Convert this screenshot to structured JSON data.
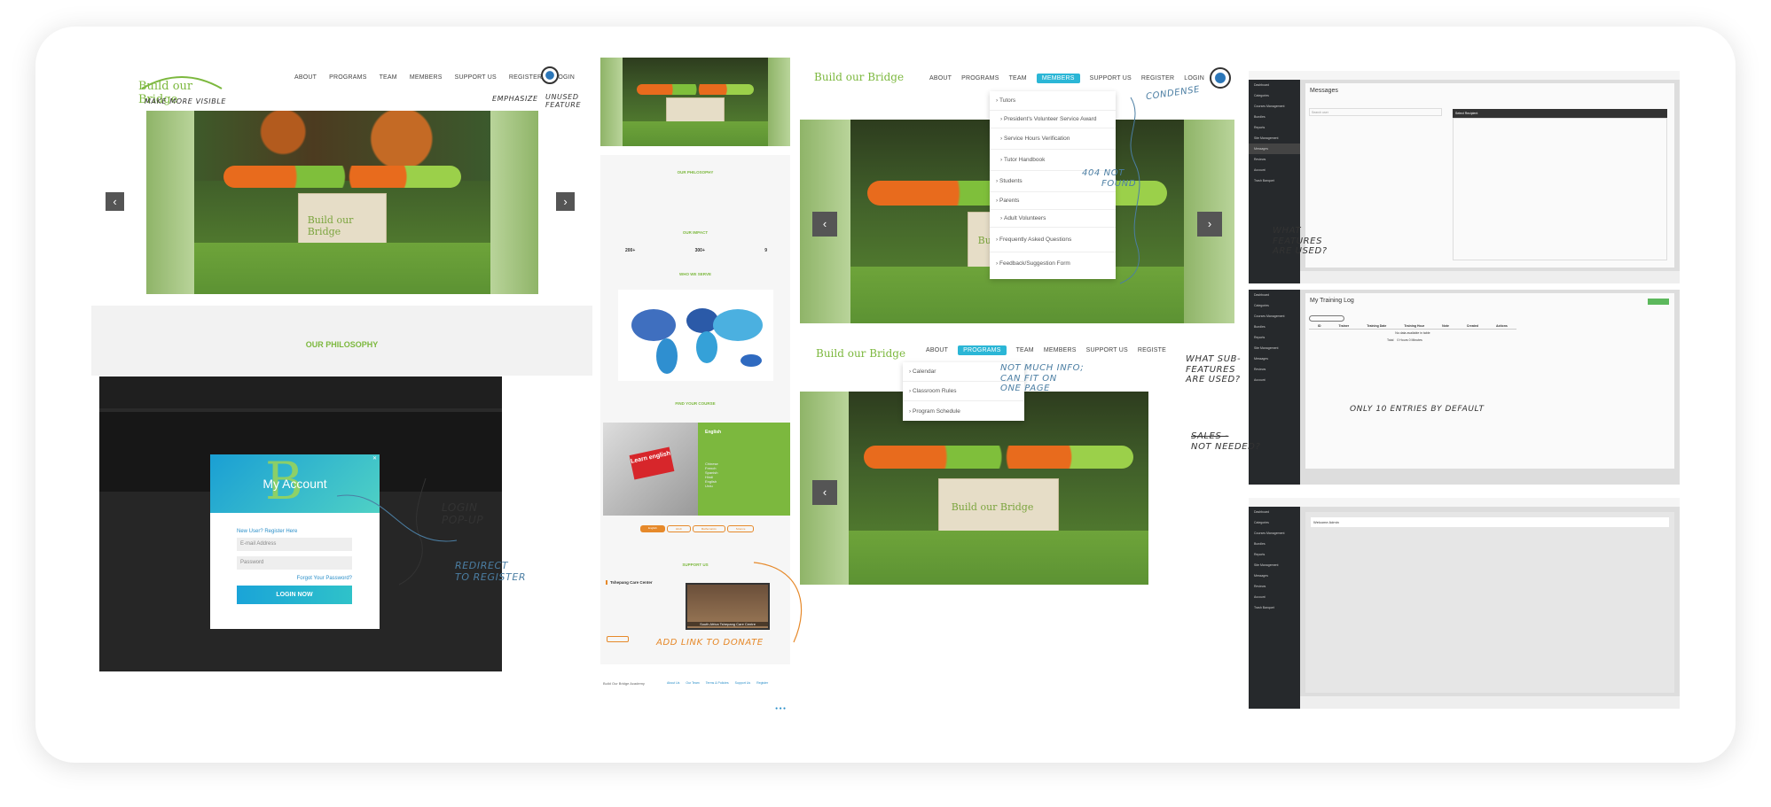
{
  "panel1": {
    "nav": [
      "ABOUT",
      "PROGRAMS",
      "TEAM",
      "MEMBERS",
      "SUPPORT US",
      "REGISTER",
      "LOGIN"
    ],
    "logo": "Build our Bridge",
    "note_logo": "MAKE MORE VISIBLE",
    "note_emph": "EMPHASIZE",
    "note_unused": [
      "UNUSED",
      "FEATURE"
    ],
    "philosophy": "OUR PHILOSOPHY"
  },
  "modal": {
    "title": "My Account",
    "new_user": "New User? Register Here",
    "email_placeholder": "E-mail Address",
    "password_placeholder": "Password",
    "forgot": "Forgot Your Password?",
    "login_button": "LOGIN NOW",
    "note_login": [
      "LOGIN",
      "POP-UP"
    ],
    "note_redirect": [
      "REDIRECT",
      "TO REGISTER"
    ]
  },
  "panel2": {
    "philosophy": "OUR PHILOSOPHY",
    "impact": "OUR IMPACT",
    "stats": [
      {
        "value": "200+",
        "label": "Tutors"
      },
      {
        "value": "300+",
        "label": "Students"
      },
      {
        "value": "9",
        "label": "Countries"
      }
    ],
    "who": "WHO WE SERVE",
    "course": "FIND YOUR COURSE",
    "course_title": "English",
    "course_image": "Learn english",
    "course_items": [
      "Chinese",
      "French",
      "Spanish",
      "Hindi",
      "English",
      "Urdu"
    ],
    "tabs": [
      "English",
      "Hindi",
      "Mathematics",
      "Science"
    ],
    "support": "SUPPORT US",
    "center_title": "Tshepang Care Center",
    "center_caption": "South Africa Tshepang Care Centre",
    "note_donate": "ADD LINK TO DONATE",
    "footer_links": [
      "About Us",
      "Our Team",
      "Terms & Policies",
      "Support Us",
      "Register"
    ]
  },
  "panel3": {
    "nav": [
      "ABOUT",
      "PROGRAMS",
      "TEAM",
      "MEMBERS",
      "SUPPORT US",
      "REGISTER",
      "LOGIN"
    ],
    "members_menu": [
      "Tutors",
      "President's Volunteer Service Award",
      "Service Hours Verification",
      "Tutor Handbook",
      "Students",
      "Parents",
      "Adult Volunteers",
      "Frequently Asked Questions",
      "Feedback/Suggestion Form"
    ],
    "note_condense": "CONDENSE",
    "note_404": [
      "404 NOT",
      "FOUND"
    ],
    "nav2": [
      "ABOUT",
      "PROGRAMS",
      "TEAM",
      "MEMBERS",
      "SUPPORT US",
      "REGISTE"
    ],
    "programs_menu": [
      "Calendar",
      "Classroom Rules",
      "Program Schedule"
    ],
    "note_info": [
      "NOT MUCH INFO;",
      "CAN FIT ON",
      "ONE PAGE"
    ]
  },
  "panel4": {
    "messages_title": "Messages",
    "search_placeholder": "Search user",
    "select_recipient": "Select Recipient",
    "note_features": [
      "WHAT",
      "FEATURES",
      "ARE USED?"
    ],
    "training_title": "My Training Log",
    "columns": [
      "ID",
      "Trainer",
      "Training Date",
      "Training Hour",
      "Note",
      "Created",
      "Actions"
    ],
    "no_data": "No data available in table",
    "total_label": "Total",
    "total_value": "0 Hours 0 Minutes",
    "note_sub": [
      "WHAT SUB-",
      "FEATURES",
      "ARE USED?"
    ],
    "note_sales": [
      "SALES -",
      "NOT NEEDED?"
    ],
    "note_entries": "ONLY 10 ENTRIES BY DEFAULT",
    "welcome": "Welcome Admin",
    "menu": [
      "Dashboard",
      "Categories",
      "Courses Management",
      "Bundles",
      "Reports",
      "Site Management",
      "Messages",
      "Reviews",
      "Account",
      "Trash Banquet"
    ]
  },
  "colors": {
    "green": "#7cb83e",
    "cyan": "#2bb6d6",
    "orange": "#e6892a",
    "note_blue": "#4b7ea3"
  }
}
